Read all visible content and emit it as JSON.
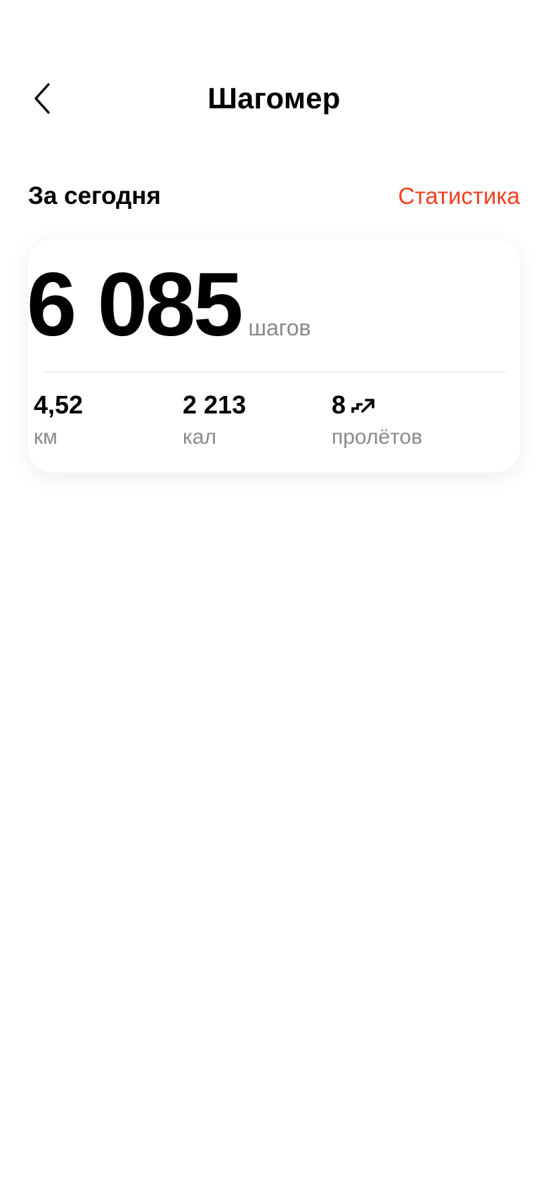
{
  "header": {
    "title": "Шагомер"
  },
  "section": {
    "title": "За сегодня",
    "link_label": "Статистика"
  },
  "card": {
    "steps_value": "6 085",
    "steps_unit": "шагов",
    "metrics": [
      {
        "value": "4,52",
        "label": "км"
      },
      {
        "value": "2 213",
        "label": "кал"
      },
      {
        "value": "8",
        "label": "пролётов",
        "icon": "stairs-icon"
      }
    ]
  },
  "colors": {
    "accent": "#f0401f",
    "secondary_text": "#8a8a8a",
    "primary_text": "#000000"
  }
}
